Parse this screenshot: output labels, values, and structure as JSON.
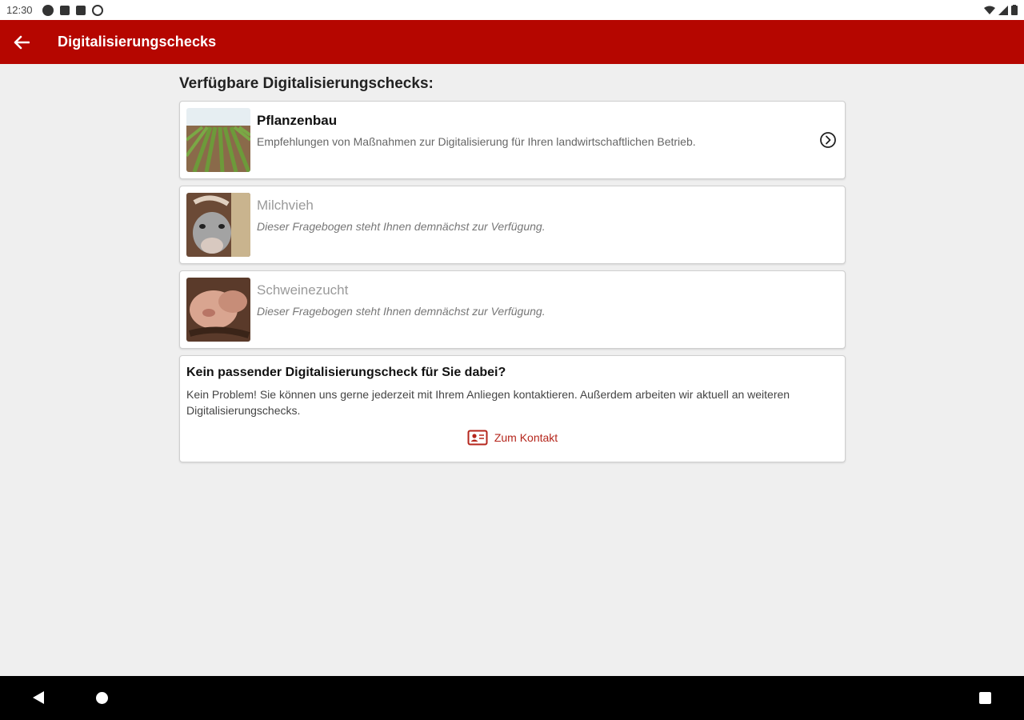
{
  "status_bar": {
    "time": "12:30"
  },
  "app_bar": {
    "title": "Digitalisierungschecks",
    "color": "#b50600"
  },
  "section_title": "Verfügbare Digitalisierungschecks:",
  "checks": [
    {
      "name": "Pflanzenbau",
      "description": "Empfehlungen von Maßnahmen zur Digitalisierung für Ihren landwirtschaftlichen Betrieb.",
      "enabled": true
    },
    {
      "name": "Milchvieh",
      "description": "Dieser Fragebogen steht Ihnen demnächst zur Verfügung.",
      "enabled": false
    },
    {
      "name": "Schweinezucht",
      "description": "Dieser Fragebogen steht Ihnen demnächst zur Verfügung.",
      "enabled": false
    }
  ],
  "info_card": {
    "title": "Kein passender Digitalisierungscheck für Sie dabei?",
    "body": "Kein Problem! Sie können uns gerne jederzeit mit Ihrem Anliegen kontaktieren. Außerdem arbeiten wir aktuell an weiteren Digitalisierungschecks.",
    "contact_label": "Zum Kontakt"
  },
  "icons": {
    "back": "arrow-back-icon",
    "chevron": "chevron-right-circle-icon",
    "contact": "contact-card-icon"
  }
}
